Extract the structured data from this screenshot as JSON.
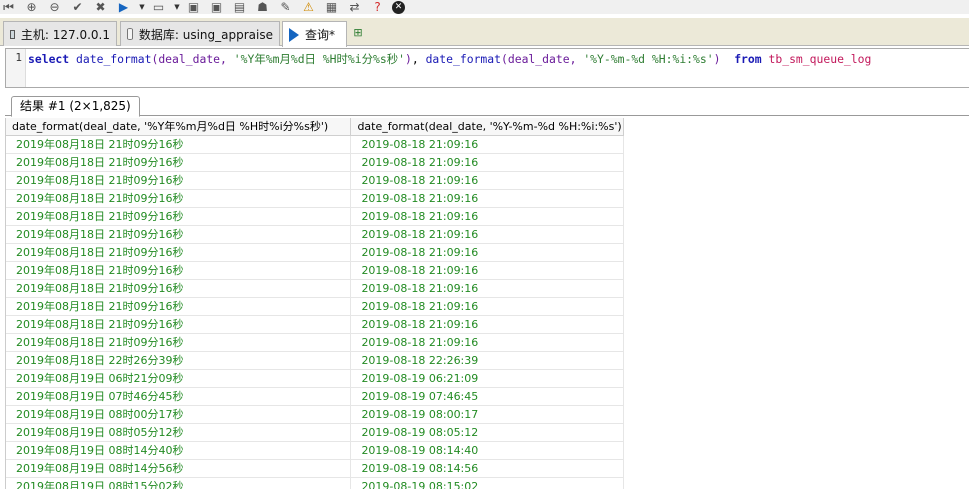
{
  "tabs": [
    {
      "label": "主机: 127.0.0.1",
      "icon": "host-icon"
    },
    {
      "label": "数据库: using_appraise",
      "icon": "database-icon"
    },
    {
      "label": "查询*",
      "icon": "play-icon"
    }
  ],
  "editor": {
    "line_number": "1",
    "tokens": {
      "select": "select",
      "fn1": "date_format",
      "open1": "(",
      "arg1": "deal_date",
      "comma1": ", ",
      "str1": "'%Y年%m月%d日 %H时%i分%s秒'",
      "close1": ")",
      "sep": ", ",
      "fn2": "date_format",
      "open2": "(",
      "arg2": "deal_date",
      "comma2": ", ",
      "str2": "'%Y-%m-%d %H:%i:%s'",
      "close2": ")",
      "from": "from",
      "table": "tb_sm_queue_log"
    }
  },
  "results_tab": {
    "label": "结果 #1 (2×1,825)"
  },
  "grid": {
    "columns": [
      "date_format(deal_date, '%Y年%m月%d日 %H时%i分%s秒')",
      "date_format(deal_date, '%Y-%m-%d %H:%i:%s')"
    ],
    "rows": [
      [
        "2019年08月18日 21时09分16秒",
        "2019-08-18 21:09:16"
      ],
      [
        "2019年08月18日 21时09分16秒",
        "2019-08-18 21:09:16"
      ],
      [
        "2019年08月18日 21时09分16秒",
        "2019-08-18 21:09:16"
      ],
      [
        "2019年08月18日 21时09分16秒",
        "2019-08-18 21:09:16"
      ],
      [
        "2019年08月18日 21时09分16秒",
        "2019-08-18 21:09:16"
      ],
      [
        "2019年08月18日 21时09分16秒",
        "2019-08-18 21:09:16"
      ],
      [
        "2019年08月18日 21时09分16秒",
        "2019-08-18 21:09:16"
      ],
      [
        "2019年08月18日 21时09分16秒",
        "2019-08-18 21:09:16"
      ],
      [
        "2019年08月18日 21时09分16秒",
        "2019-08-18 21:09:16"
      ],
      [
        "2019年08月18日 21时09分16秒",
        "2019-08-18 21:09:16"
      ],
      [
        "2019年08月18日 21时09分16秒",
        "2019-08-18 21:09:16"
      ],
      [
        "2019年08月18日 21时09分16秒",
        "2019-08-18 21:09:16"
      ],
      [
        "2019年08月18日 22时26分39秒",
        "2019-08-18 22:26:39"
      ],
      [
        "2019年08月19日 06时21分09秒",
        "2019-08-19 06:21:09"
      ],
      [
        "2019年08月19日 07时46分45秒",
        "2019-08-19 07:46:45"
      ],
      [
        "2019年08月19日 08时00分17秒",
        "2019-08-19 08:00:17"
      ],
      [
        "2019年08月19日 08时05分12秒",
        "2019-08-19 08:05:12"
      ],
      [
        "2019年08月19日 08时14分40秒",
        "2019-08-19 08:14:40"
      ],
      [
        "2019年08月19日 08时14分56秒",
        "2019-08-19 08:14:56"
      ],
      [
        "2019年08月19日 08时15分02秒",
        "2019-08-19 08:15:02"
      ]
    ]
  },
  "colors": {
    "cell_text": "#228b22",
    "keyword": "#1a1ab5",
    "string": "#2e7d32",
    "table": "#c2185b"
  }
}
